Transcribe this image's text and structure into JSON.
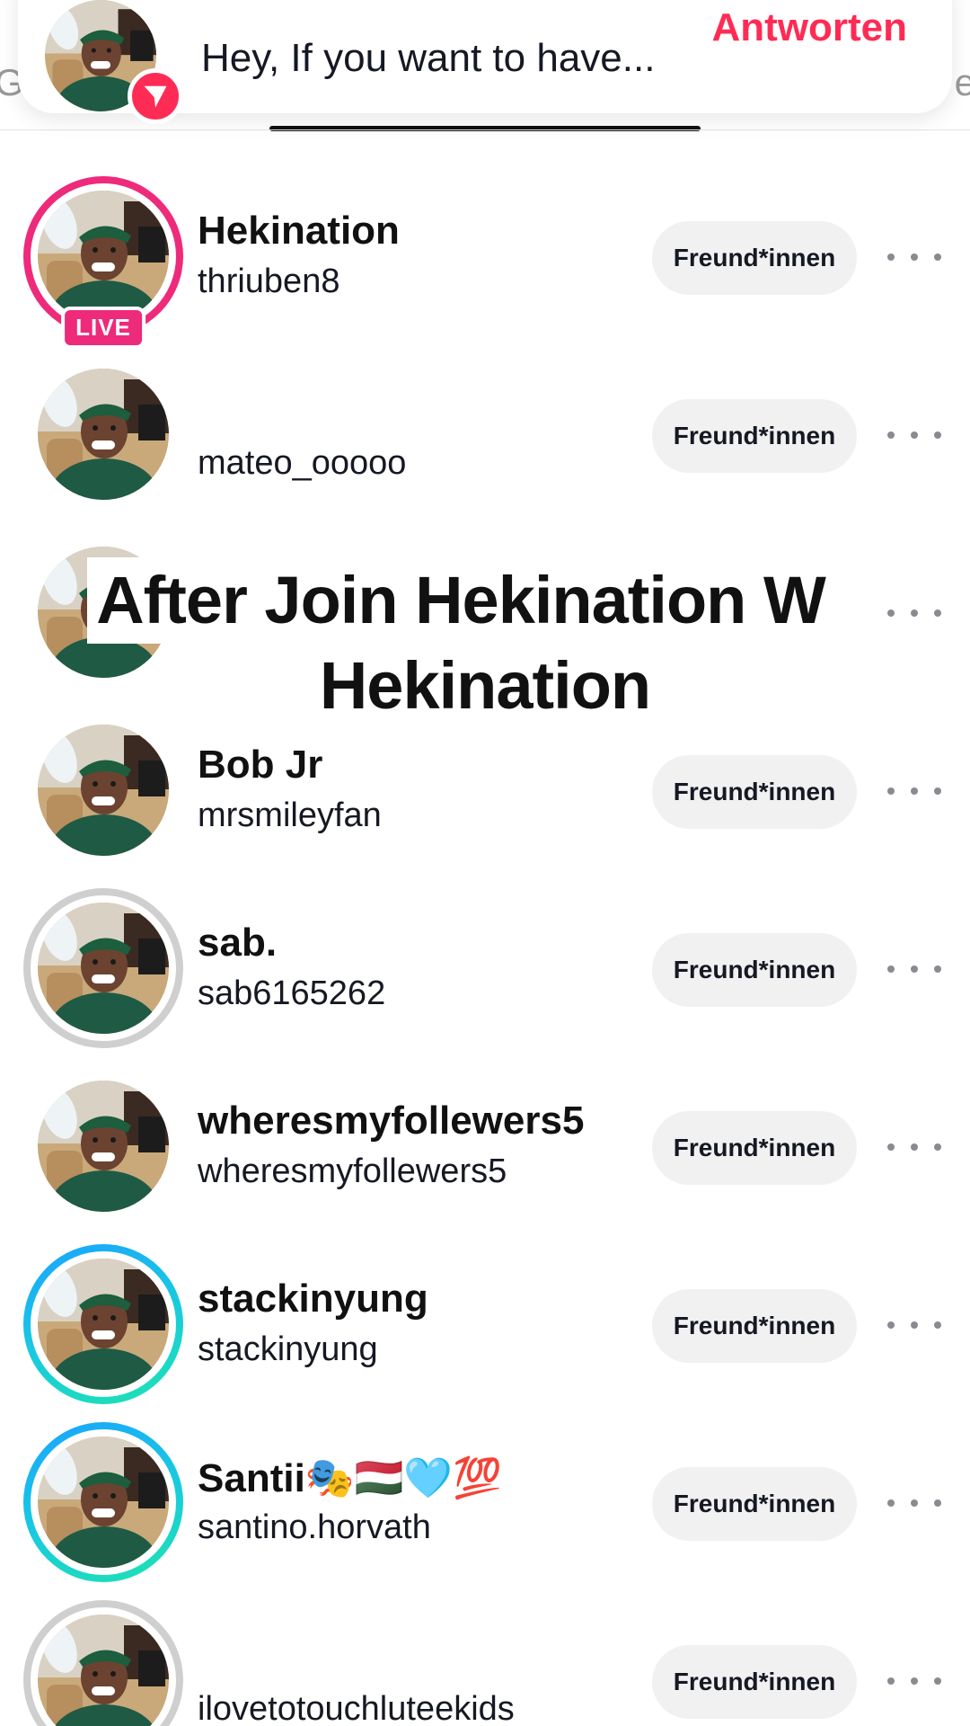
{
  "banner": {
    "message": "Hey, If you want to have...",
    "reply_label": "Antworten",
    "edge_left": "G",
    "edge_right": "e"
  },
  "overlay_caption": {
    "line1": "After Join Hekination W",
    "line2": "Hekination"
  },
  "follow_button_label": "Freund*innen",
  "live_label": "LIVE",
  "rows": [
    {
      "name": "Hekination",
      "handle": "thriuben8",
      "ring": "live"
    },
    {
      "name": "",
      "handle": "mateo_ooooo",
      "ring": "none"
    },
    {
      "name": "",
      "handle": "",
      "ring": "none"
    },
    {
      "name": "Bob Jr",
      "handle": "mrsmileyfan",
      "ring": "none"
    },
    {
      "name": "sab.",
      "handle": "sab6165262",
      "ring": "grey"
    },
    {
      "name": "wheresmyfollewers5",
      "handle": "wheresmyfollewers5",
      "ring": "none"
    },
    {
      "name": "stackinyung",
      "handle": "stackinyung",
      "ring": "close"
    },
    {
      "name": "Santii🎭🇭🇺🩵💯",
      "handle": "santino.horvath",
      "ring": "close"
    },
    {
      "name": "",
      "handle": "ilovetotouchluteekids",
      "ring": "grey"
    }
  ],
  "colors": {
    "accent": "#fe2c55",
    "live_ring": "#ee2a7b",
    "button_bg": "#f1f1f2"
  }
}
